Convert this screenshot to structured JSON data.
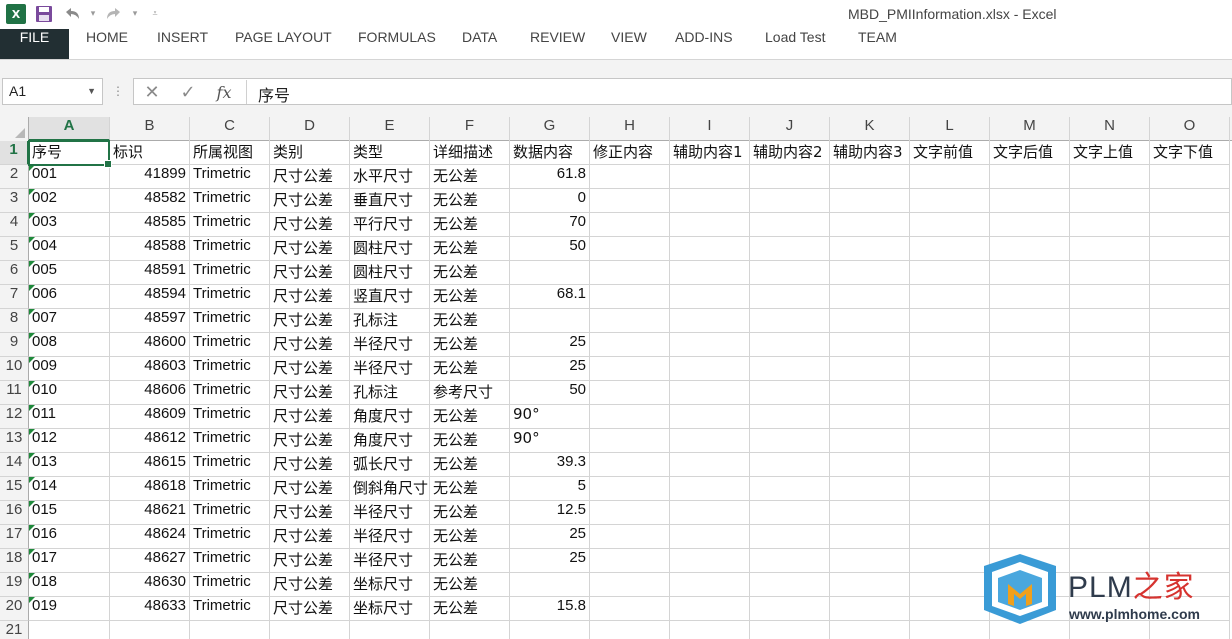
{
  "window": {
    "title": "MBD_PMIInformation.xlsx - Excel"
  },
  "ribbon": {
    "tabs": [
      {
        "label": "FILE"
      },
      {
        "label": "HOME"
      },
      {
        "label": "INSERT"
      },
      {
        "label": "PAGE LAYOUT"
      },
      {
        "label": "FORMULAS"
      },
      {
        "label": "DATA"
      },
      {
        "label": "REVIEW"
      },
      {
        "label": "VIEW"
      },
      {
        "label": "ADD-INS"
      },
      {
        "label": "Load Test"
      },
      {
        "label": "TEAM"
      }
    ]
  },
  "formula_bar": {
    "name_box": "A1",
    "content": "序号",
    "fx_label": "fx"
  },
  "sheet": {
    "selected_cell": "A1",
    "columns": [
      "A",
      "B",
      "C",
      "D",
      "E",
      "F",
      "G",
      "H",
      "I",
      "J",
      "K",
      "L",
      "M",
      "N",
      "O"
    ],
    "rows": [
      [
        "序号",
        "标识",
        "所属视图",
        "类别",
        "类型",
        "详细描述",
        "数据内容",
        "修正内容",
        "辅助内容1",
        "辅助内容2",
        "辅助内容3",
        "文字前值",
        "文字后值",
        "文字上值",
        "文字下值"
      ],
      [
        "001",
        "41899",
        "Trimetric",
        "尺寸公差",
        "水平尺寸",
        "无公差",
        "61.8",
        "",
        "",
        "",
        "",
        "",
        "",
        "",
        ""
      ],
      [
        "002",
        "48582",
        "Trimetric",
        "尺寸公差",
        "垂直尺寸",
        "无公差",
        "0",
        "",
        "",
        "",
        "",
        "",
        "",
        "",
        ""
      ],
      [
        "003",
        "48585",
        "Trimetric",
        "尺寸公差",
        "平行尺寸",
        "无公差",
        "70",
        "",
        "",
        "",
        "",
        "",
        "",
        "",
        ""
      ],
      [
        "004",
        "48588",
        "Trimetric",
        "尺寸公差",
        "圆柱尺寸",
        "无公差",
        "50",
        "",
        "",
        "",
        "",
        "",
        "",
        "",
        ""
      ],
      [
        "005",
        "48591",
        "Trimetric",
        "尺寸公差",
        "圆柱尺寸",
        "无公差",
        "",
        "",
        "",
        "",
        "",
        "",
        "",
        "",
        ""
      ],
      [
        "006",
        "48594",
        "Trimetric",
        "尺寸公差",
        "竖直尺寸",
        "无公差",
        "68.1",
        "",
        "",
        "",
        "",
        "",
        "",
        "",
        ""
      ],
      [
        "007",
        "48597",
        "Trimetric",
        "尺寸公差",
        "孔标注",
        "无公差",
        "",
        "",
        "",
        "",
        "",
        "",
        "",
        "",
        ""
      ],
      [
        "008",
        "48600",
        "Trimetric",
        "尺寸公差",
        "半径尺寸",
        "无公差",
        "25",
        "",
        "",
        "",
        "",
        "",
        "",
        "",
        ""
      ],
      [
        "009",
        "48603",
        "Trimetric",
        "尺寸公差",
        "半径尺寸",
        "无公差",
        "25",
        "",
        "",
        "",
        "",
        "",
        "",
        "",
        ""
      ],
      [
        "010",
        "48606",
        "Trimetric",
        "尺寸公差",
        "孔标注",
        "参考尺寸",
        "50",
        "",
        "",
        "",
        "",
        "",
        "",
        "",
        ""
      ],
      [
        "011",
        "48609",
        "Trimetric",
        "尺寸公差",
        "角度尺寸",
        "无公差",
        "90°",
        "",
        "",
        "",
        "",
        "",
        "",
        "",
        ""
      ],
      [
        "012",
        "48612",
        "Trimetric",
        "尺寸公差",
        "角度尺寸",
        "无公差",
        "90°",
        "",
        "",
        "",
        "",
        "",
        "",
        "",
        ""
      ],
      [
        "013",
        "48615",
        "Trimetric",
        "尺寸公差",
        "弧长尺寸",
        "无公差",
        "39.3",
        "",
        "",
        "",
        "",
        "",
        "",
        "",
        ""
      ],
      [
        "014",
        "48618",
        "Trimetric",
        "尺寸公差",
        "倒斜角尺寸",
        "无公差",
        "5",
        "",
        "",
        "",
        "",
        "",
        "",
        "",
        ""
      ],
      [
        "015",
        "48621",
        "Trimetric",
        "尺寸公差",
        "半径尺寸",
        "无公差",
        "12.5",
        "",
        "",
        "",
        "",
        "",
        "",
        "",
        ""
      ],
      [
        "016",
        "48624",
        "Trimetric",
        "尺寸公差",
        "半径尺寸",
        "无公差",
        "25",
        "",
        "",
        "",
        "",
        "",
        "",
        "",
        ""
      ],
      [
        "017",
        "48627",
        "Trimetric",
        "尺寸公差",
        "半径尺寸",
        "无公差",
        "25",
        "",
        "",
        "",
        "",
        "",
        "",
        "",
        ""
      ],
      [
        "018",
        "48630",
        "Trimetric",
        "尺寸公差",
        "坐标尺寸",
        "无公差",
        "",
        "",
        "",
        "",
        "",
        "",
        "",
        "",
        ""
      ],
      [
        "019",
        "48633",
        "Trimetric",
        "尺寸公差",
        "坐标尺寸",
        "无公差",
        "15.8",
        "",
        "",
        "",
        "",
        "",
        "",
        "",
        ""
      ],
      [
        "",
        "",
        "",
        "",
        "",
        "",
        "",
        "",
        "",
        "",
        "",
        "",
        "",
        "",
        ""
      ]
    ]
  },
  "watermark": {
    "brand": "PLM",
    "brand_zh": "之家",
    "url": "www.plmhome.com"
  },
  "colors": {
    "excel_green": "#217346",
    "file_tab": "#222f33",
    "triangle": "#1f8a3b"
  }
}
